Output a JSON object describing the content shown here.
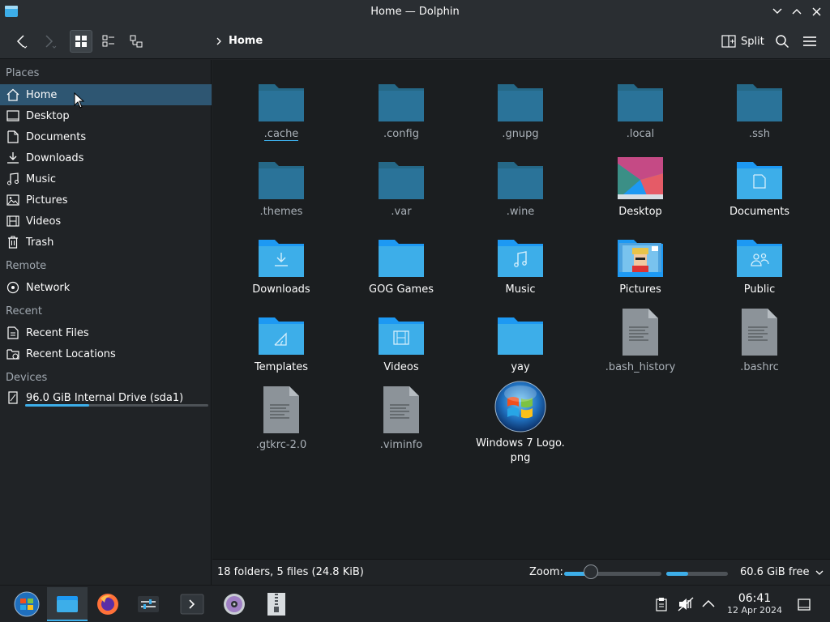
{
  "window": {
    "title": "Home — Dolphin"
  },
  "toolbar": {
    "breadcrumb": "Home",
    "split_label": "Split"
  },
  "sidebar": {
    "sections": [
      {
        "heading": "Places",
        "items": [
          {
            "label": "Home",
            "icon": "home-icon",
            "selected": true
          },
          {
            "label": "Desktop",
            "icon": "desktop-icon"
          },
          {
            "label": "Documents",
            "icon": "documents-icon"
          },
          {
            "label": "Downloads",
            "icon": "download-icon"
          },
          {
            "label": "Music",
            "icon": "music-icon"
          },
          {
            "label": "Pictures",
            "icon": "pictures-icon"
          },
          {
            "label": "Videos",
            "icon": "videos-icon"
          },
          {
            "label": "Trash",
            "icon": "trash-icon"
          }
        ]
      },
      {
        "heading": "Remote",
        "items": [
          {
            "label": "Network",
            "icon": "network-icon"
          }
        ]
      },
      {
        "heading": "Recent",
        "items": [
          {
            "label": "Recent Files",
            "icon": "recent-files-icon"
          },
          {
            "label": "Recent Locations",
            "icon": "recent-locations-icon"
          }
        ]
      },
      {
        "heading": "Devices",
        "items": [
          {
            "label": "96.0 GiB Internal Drive (sda1)",
            "icon": "drive-icon",
            "usage_fraction": 0.35
          }
        ]
      }
    ]
  },
  "files": [
    {
      "name": ".cache",
      "kind": "folder-dark"
    },
    {
      "name": ".config",
      "kind": "folder-dark"
    },
    {
      "name": ".gnupg",
      "kind": "folder-dark"
    },
    {
      "name": ".local",
      "kind": "folder-dark"
    },
    {
      "name": ".ssh",
      "kind": "folder-dark"
    },
    {
      "name": ".themes",
      "kind": "folder-dark"
    },
    {
      "name": ".var",
      "kind": "folder-dark"
    },
    {
      "name": ".wine",
      "kind": "folder-dark"
    },
    {
      "name": "Desktop",
      "kind": "desktop-folder"
    },
    {
      "name": "Documents",
      "kind": "documents-folder"
    },
    {
      "name": "Downloads",
      "kind": "downloads-folder"
    },
    {
      "name": "GOG Games",
      "kind": "folder"
    },
    {
      "name": "Music",
      "kind": "music-folder"
    },
    {
      "name": "Pictures",
      "kind": "pictures-folder"
    },
    {
      "name": "Public",
      "kind": "public-folder"
    },
    {
      "name": "Templates",
      "kind": "templates-folder"
    },
    {
      "name": "Videos",
      "kind": "videos-folder"
    },
    {
      "name": "yay",
      "kind": "folder"
    },
    {
      "name": ".bash_history",
      "kind": "text-file"
    },
    {
      "name": ".bashrc",
      "kind": "text-file"
    },
    {
      "name": ".gtkrc-2.0",
      "kind": "text-file"
    },
    {
      "name": ".viminfo",
      "kind": "text-file"
    },
    {
      "name": "Windows 7 Logo.png",
      "name_line1": "Windows 7 Logo.",
      "name_line2": "png",
      "kind": "image-file"
    }
  ],
  "status": {
    "summary": "18 folders, 5 files (24.8 KiB)",
    "zoom_label": "Zoom:",
    "zoom_fraction": 0.3,
    "free_space": "60.6 GiB free",
    "free_used_fraction": 0.35
  },
  "taskbar": {
    "apps": [
      "start-menu",
      "dolphin",
      "firefox",
      "settings",
      "konsole",
      "disc-burner",
      "archiver"
    ],
    "time": "06:41",
    "date": "12 Apr 2024"
  },
  "colors": {
    "accent": "#3daee9",
    "folder_dark": "#2a6e94",
    "folder": "#3daee9"
  }
}
